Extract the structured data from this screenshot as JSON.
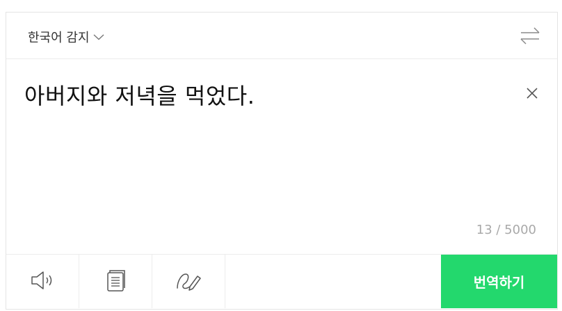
{
  "source_language": {
    "label": "한국어 감지"
  },
  "input": {
    "text": "아버지와 저녁을 먹었다."
  },
  "counter": {
    "text": "13 / 5000"
  },
  "toolbar": {
    "tools": [
      "speaker-icon",
      "dictionary-icon",
      "handwriting-icon"
    ],
    "translate_label": "번역하기"
  },
  "colors": {
    "accent": "#23d86d",
    "counter": "#a9a9a9",
    "border": "#e4e4e4"
  }
}
